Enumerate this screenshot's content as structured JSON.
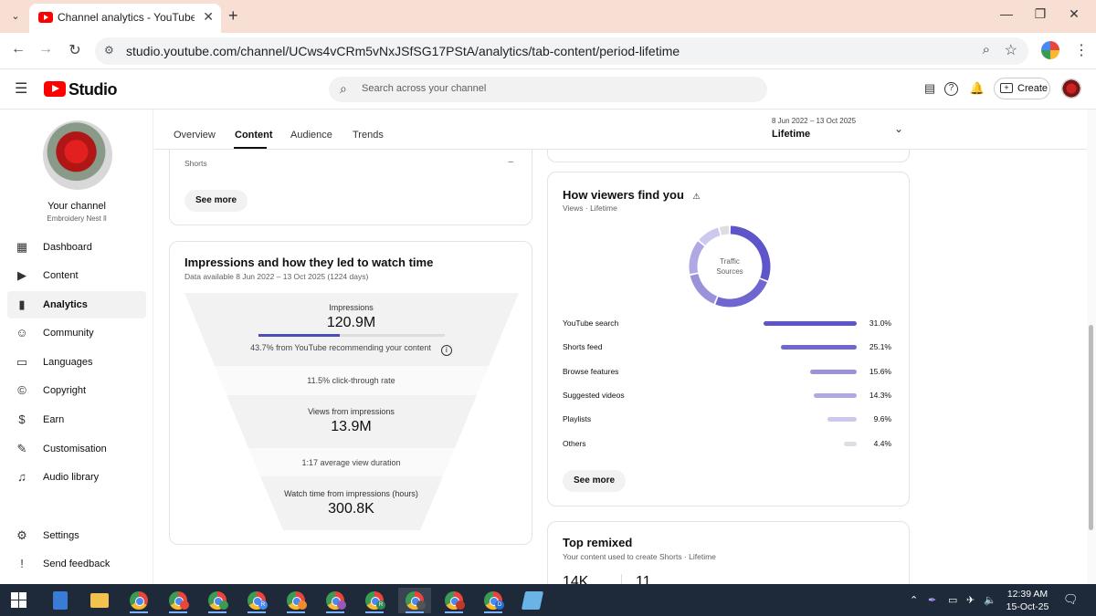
{
  "browser": {
    "tab_title": "Channel analytics - YouTube Studio",
    "url": "studio.youtube.com/channel/UCws4vCRm5vNxJSfSG17PStA/analytics/tab-content/period-lifetime",
    "new_tab": "+",
    "controls": {
      "minimize": "—",
      "restore": "❐",
      "close": "✕"
    }
  },
  "header": {
    "logo_text": "Studio",
    "search_placeholder": "Search across your channel",
    "create_label": "Create"
  },
  "sidebar": {
    "channel_name": "Your channel",
    "channel_handle": "Embroidery Nest ll",
    "items": [
      {
        "label": "Dashboard",
        "icon": "dashboard-icon"
      },
      {
        "label": "Content",
        "icon": "content-icon"
      },
      {
        "label": "Analytics",
        "icon": "analytics-icon",
        "active": true
      },
      {
        "label": "Community",
        "icon": "community-icon"
      },
      {
        "label": "Languages",
        "icon": "languages-icon"
      },
      {
        "label": "Copyright",
        "icon": "copyright-icon"
      },
      {
        "label": "Earn",
        "icon": "earn-icon"
      },
      {
        "label": "Customisation",
        "icon": "customisation-icon"
      },
      {
        "label": "Audio library",
        "icon": "audio-library-icon"
      }
    ],
    "bottom_items": [
      {
        "label": "Settings",
        "icon": "settings-icon"
      },
      {
        "label": "Send feedback",
        "icon": "feedback-icon"
      }
    ]
  },
  "tabs": [
    "Overview",
    "Content",
    "Audience",
    "Trends"
  ],
  "active_tab": "Content",
  "period": {
    "range": "8 Jun 2022 – 13 Oct 2025",
    "value": "Lifetime"
  },
  "shorts_card": {
    "row_label": "Shorts",
    "row_value": "–",
    "button": "See more"
  },
  "impressions_card": {
    "title": "Impressions and how they led to watch time",
    "subtitle": "Data available 8 Jun 2022 – 13 Oct 2025 (1224 days)",
    "impressions_label": "Impressions",
    "impressions_value": "120.9M",
    "recommend_text": "43.7% from YouTube recommending your content",
    "recommend_fraction": 0.437,
    "ctr_text": "11.5% click-through rate",
    "views_label": "Views from impressions",
    "views_value": "13.9M",
    "avd_text": "1:17 average view duration",
    "watch_label": "Watch time from impressions (hours)",
    "watch_value": "300.8K"
  },
  "viewers_card": {
    "title": "How viewers find you",
    "subtitle": "Views · Lifetime",
    "donut_label_1": "Traffic",
    "donut_label_2": "Sources",
    "sources": [
      {
        "label": "YouTube search",
        "pct": "31.0%",
        "value": 31.0,
        "color": "#5d55c9"
      },
      {
        "label": "Shorts feed",
        "pct": "25.1%",
        "value": 25.1,
        "color": "#6f67cf"
      },
      {
        "label": "Browse features",
        "pct": "15.6%",
        "value": 15.6,
        "color": "#9a93dc"
      },
      {
        "label": "Suggested videos",
        "pct": "14.3%",
        "value": 14.3,
        "color": "#aea8e4"
      },
      {
        "label": "Playlists",
        "pct": "9.6%",
        "value": 9.6,
        "color": "#cdc9ee"
      },
      {
        "label": "Others",
        "pct": "4.4%",
        "value": 4.4,
        "color": "#dedde5"
      }
    ],
    "button": "See more"
  },
  "remix_card": {
    "title": "Top remixed",
    "subtitle": "Your content used to create Shorts · Lifetime",
    "stat_1": "14K",
    "stat_2": "11"
  },
  "taskbar": {
    "time": "12:39 AM",
    "date": "15-Oct-25",
    "apps": [
      {
        "name": "calculator",
        "badge": "",
        "color": "#3a7bd5"
      },
      {
        "name": "file-explorer",
        "badge": "",
        "color": "#f2c14e"
      },
      {
        "name": "chrome",
        "badge": "",
        "color": ""
      },
      {
        "name": "chrome",
        "badge": "",
        "color": "#e8453c"
      },
      {
        "name": "chrome",
        "badge": "",
        "color": "#3b9a54"
      },
      {
        "name": "chrome",
        "badge": "R",
        "color": "#4a89f3"
      },
      {
        "name": "chrome",
        "badge": "",
        "color": "#f28b30"
      },
      {
        "name": "chrome",
        "badge": "",
        "color": "#9b59b6"
      },
      {
        "name": "chrome",
        "badge": "R",
        "color": "#2e8b57"
      },
      {
        "name": "chrome",
        "badge": "",
        "color": "#555",
        "active": true
      },
      {
        "name": "chrome",
        "badge": "",
        "color": "#c0392b"
      },
      {
        "name": "chrome",
        "badge": "D",
        "color": "#2b6cd1"
      },
      {
        "name": "notepad",
        "badge": "",
        "color": "#69b3e7"
      }
    ]
  }
}
